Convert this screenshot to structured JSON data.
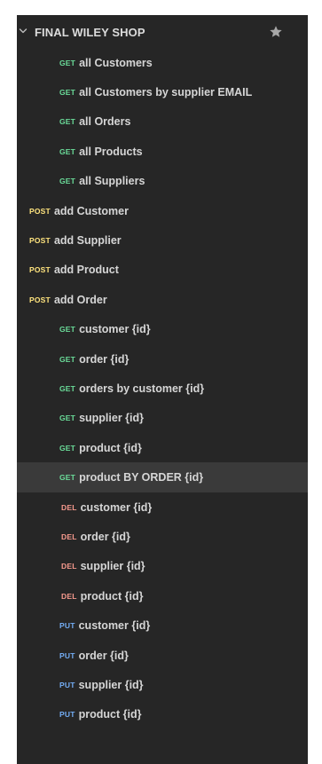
{
  "collection": {
    "title": "FINAL WILEY SHOP",
    "expanded": true,
    "starred": false
  },
  "requests": [
    {
      "method": "GET",
      "name": "all Customers",
      "indent": "get"
    },
    {
      "method": "GET",
      "name": "all Customers by supplier EMAIL",
      "indent": "get"
    },
    {
      "method": "GET",
      "name": "all Orders",
      "indent": "get"
    },
    {
      "method": "GET",
      "name": "all Products",
      "indent": "get"
    },
    {
      "method": "GET",
      "name": "all Suppliers",
      "indent": "get"
    },
    {
      "method": "POST",
      "name": "add Customer",
      "indent": "post"
    },
    {
      "method": "POST",
      "name": "add Supplier",
      "indent": "post"
    },
    {
      "method": "POST",
      "name": "add Product",
      "indent": "post"
    },
    {
      "method": "POST",
      "name": "add Order",
      "indent": "post"
    },
    {
      "method": "GET",
      "name": "customer {id}",
      "indent": "short"
    },
    {
      "method": "GET",
      "name": "order {id}",
      "indent": "short"
    },
    {
      "method": "GET",
      "name": "orders by customer {id}",
      "indent": "short"
    },
    {
      "method": "GET",
      "name": "supplier {id}",
      "indent": "short"
    },
    {
      "method": "GET",
      "name": "product {id}",
      "indent": "short"
    },
    {
      "method": "GET",
      "name": "product BY ORDER {id}",
      "indent": "short",
      "selected": true
    },
    {
      "method": "DEL",
      "name": "customer {id}",
      "indent": "del"
    },
    {
      "method": "DEL",
      "name": "order {id}",
      "indent": "del"
    },
    {
      "method": "DEL",
      "name": "supplier {id}",
      "indent": "del"
    },
    {
      "method": "DEL",
      "name": "product {id}",
      "indent": "del"
    },
    {
      "method": "PUT",
      "name": "customer {id}",
      "indent": "put"
    },
    {
      "method": "PUT",
      "name": "order {id}",
      "indent": "put"
    },
    {
      "method": "PUT",
      "name": "supplier {id}",
      "indent": "put"
    },
    {
      "method": "PUT",
      "name": "product {id}",
      "indent": "put"
    }
  ],
  "icons": {
    "collapse": "chevron-down-icon",
    "favorite": "star-icon"
  },
  "colors": {
    "panel_bg": "#262626",
    "selected_bg": "#3a3a3a",
    "GET": "#6bdd9a",
    "POST": "#ffe47e",
    "DEL": "#f79a8e",
    "PUT": "#74aef6"
  }
}
